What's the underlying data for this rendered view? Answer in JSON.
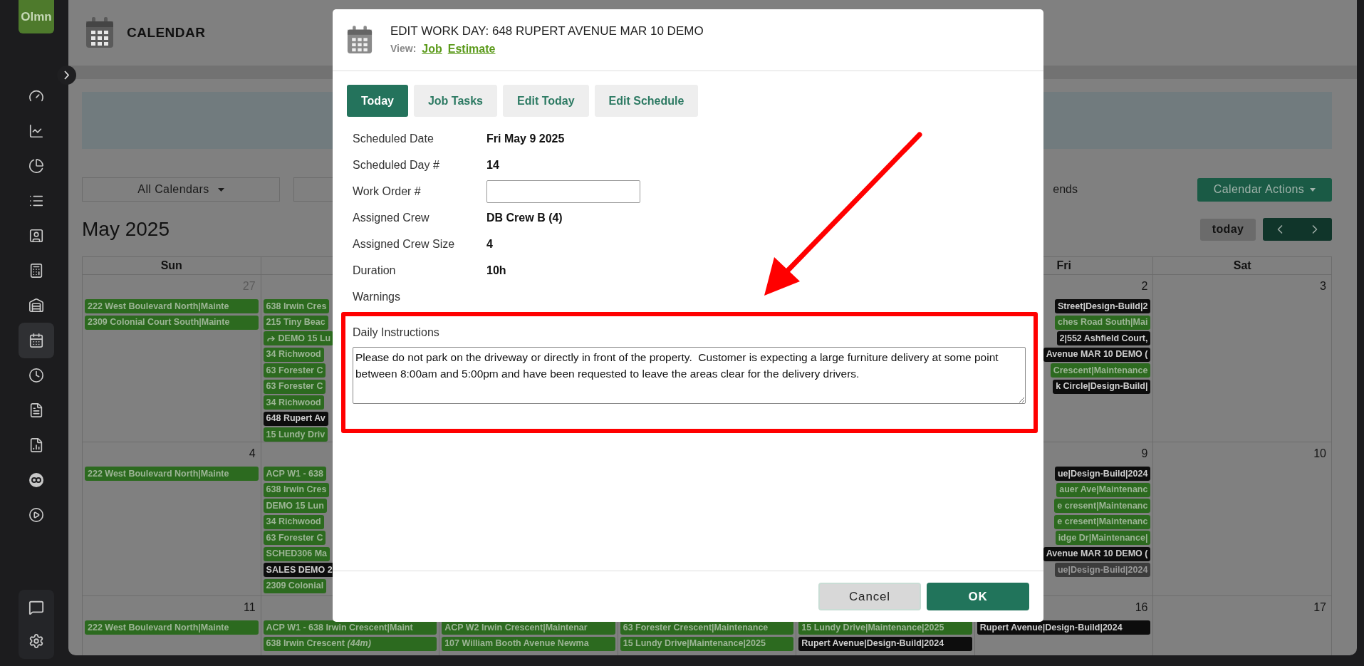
{
  "sidebar": {
    "logo": "Olmn",
    "items": [
      {
        "selected": false
      },
      {
        "selected": false
      },
      {
        "selected": false
      },
      {
        "selected": false
      },
      {
        "selected": false
      },
      {
        "selected": false
      },
      {
        "selected": false
      },
      {
        "selected": true
      },
      {
        "selected": false
      },
      {
        "selected": false
      },
      {
        "selected": false
      },
      {
        "selected": false
      },
      {
        "selected": false
      }
    ]
  },
  "page": {
    "title": "CALENDAR",
    "filter": "All Calendars",
    "weekends_label": "ends",
    "actions": "Calendar Actions",
    "today": "today",
    "month": "May 2025"
  },
  "calendar": {
    "rows": [
      {
        "cells": [
          {
            "weekday": "Sun",
            "day": "27",
            "other_month": true,
            "events": [
              {
                "text": "222 West Boulevard North|Mainte",
                "color": "#2c6a1f",
                "moved": false
              },
              {
                "text": "2309 Colonial Court South|Mainte",
                "color": "#2c6a1f",
                "moved": false
              }
            ]
          },
          {
            "events": [
              {
                "text": "638 Irwin Cres",
                "color": "#2c6a1f",
                "moved": false
              },
              {
                "text": "215 Tiny Beac",
                "color": "#2c6a1f",
                "moved": false
              },
              {
                "text": "DEMO 15 Lu",
                "color": "#2c6a1f",
                "moved": true
              },
              {
                "text": "34 Richwood",
                "color": "#2c6a1f",
                "moved": false
              },
              {
                "text": "63 Forester C",
                "color": "#2c6a1f",
                "moved": false
              },
              {
                "text": "63 Forester C",
                "color": "#2c6a1f",
                "moved": false
              },
              {
                "text": "34 Richwood",
                "color": "#2c6a1f",
                "moved": false
              },
              {
                "text": "648 Rupert Av",
                "color": "#0d0d0d",
                "moved": false
              },
              {
                "text": "15 Lundy Driv",
                "color": "#2c6a1f",
                "moved": false
              }
            ]
          },
          {},
          {},
          {},
          {
            "weekday": "Fri",
            "day": "2",
            "other_month": false,
            "events": [
              {
                "text": "Street|Design-Build|2",
                "color": "#0d0d0d",
                "moved": false
              },
              {
                "text": "ches Road South|Mai",
                "color": "#2c6a1f",
                "moved": false
              },
              {
                "text": "2|552 Ashfield Court,",
                "color": "#0d0d0d",
                "moved": false
              },
              {
                "text": "Avenue MAR 10 DEMO (",
                "color": "#0d0d0d",
                "moved": false
              },
              {
                "text": "Crescent|Maintenance",
                "color": "#2c6a1f",
                "moved": false
              },
              {
                "text": "k Circle|Design-Build|",
                "color": "#0d0d0d",
                "moved": false
              }
            ]
          },
          {
            "weekday": "Sat",
            "day": "3",
            "other_month": false
          }
        ]
      },
      {
        "cells": [
          {
            "day": "4",
            "other_month": false,
            "events": [
              {
                "text": "222 West Boulevard North|Mainte",
                "color": "#2c6a1f",
                "moved": false
              }
            ]
          },
          {
            "events": [
              {
                "text": "ACP W1 - 638",
                "color": "#2c6a1f",
                "moved": false
              },
              {
                "text": "638 Irwin Cres",
                "color": "#2c6a1f",
                "moved": false
              },
              {
                "text": "DEMO 15 Lun",
                "color": "#2c6a1f",
                "moved": false
              },
              {
                "text": "34 Richwood",
                "color": "#2c6a1f",
                "moved": false
              },
              {
                "text": "63 Forester C",
                "color": "#2c6a1f",
                "moved": false
              },
              {
                "text": "SCHED306 Ma",
                "color": "#2c6a1f",
                "moved": false
              },
              {
                "text": "SALES DEMO 2",
                "color": "#0d0d0d",
                "moved": false
              },
              {
                "text": "2309 Colonial",
                "color": "#2c6a1f",
                "moved": false
              }
            ]
          },
          {},
          {},
          {},
          {
            "day": "9",
            "other_month": false,
            "events": [
              {
                "text": "ue|Design-Build|2024",
                "color": "#0d0d0d",
                "moved": false
              },
              {
                "text": "auer Ave|Maintenanc",
                "color": "#2c6a1f",
                "moved": false
              },
              {
                "text": "e cresent|Maintenanc",
                "color": "#2c6a1f",
                "moved": false
              },
              {
                "text": "e cresent|Maintenanc",
                "color": "#2c6a1f",
                "moved": false
              },
              {
                "text": "idge Dr|Maintenance|",
                "color": "#2c6a1f",
                "moved": false
              },
              {
                "text": "Avenue MAR 10 DEMO (",
                "color": "#0d0d0d",
                "moved": false
              },
              {
                "text": "ue|Design-Build|2024",
                "color": "#3c3c3c",
                "moved": false
              }
            ]
          },
          {
            "day": "10",
            "other_month": false
          }
        ]
      },
      {
        "cells": [
          {
            "day": "11",
            "other_month": false,
            "events": [
              {
                "text": "222 West Boulevard North|Mainte",
                "color": "#2c6a1f",
                "moved": false
              }
            ]
          },
          {
            "events": [
              {
                "text": "ACP W1 - 638 Irwin Crescent|Maint",
                "color": "#2c6a1f",
                "moved": false
              },
              {
                "text": "638 Irwin Crescent *(44m)*",
                "color": "#2c6a1f",
                "moved": false
              }
            ]
          },
          {
            "events": [
              {
                "text": "ACP W2 Irwin Crescent|Maintenar",
                "color": "#2c6a1f",
                "moved": false
              },
              {
                "text": "107 William Booth Avenue Newma",
                "color": "#2c6a1f",
                "moved": false
              }
            ]
          },
          {
            "events": [
              {
                "text": "63 Forester Crescent|Maintenance",
                "color": "#2c6a1f",
                "moved": false
              },
              {
                "text": "15 Lundy Drive|Maintenance|2025",
                "color": "#2c6a1f",
                "moved": false
              }
            ]
          },
          {
            "events": [
              {
                "text": "15 Lundy Drive|Maintenance|2025",
                "color": "#2c6a1f",
                "moved": false
              },
              {
                "text": "Rupert Avenue|Design-Build|2024",
                "color": "#0d0d0d",
                "moved": false
              }
            ]
          },
          {
            "day": "16",
            "other_month": false,
            "events": [
              {
                "text": "Rupert Avenue|Design-Build|2024",
                "color": "#0d0d0d",
                "moved": false
              }
            ]
          },
          {
            "day": "17",
            "other_month": false
          }
        ]
      }
    ]
  },
  "modal": {
    "title": "EDIT WORK DAY: 648 RUPERT AVENUE MAR 10 DEMO",
    "view_label": "View:",
    "links": [
      "Job",
      "Estimate"
    ],
    "tabs": [
      {
        "label": "Today",
        "selected": true
      },
      {
        "label": "Job Tasks",
        "selected": false
      },
      {
        "label": "Edit Today",
        "selected": false
      },
      {
        "label": "Edit Schedule",
        "selected": false
      }
    ],
    "fields": [
      {
        "label": "Scheduled Date",
        "kind": "text",
        "value": "Fri May 9 2025"
      },
      {
        "label": "Scheduled Day #",
        "kind": "text",
        "value": "14"
      },
      {
        "label": "Work Order #",
        "kind": "input"
      },
      {
        "label": "Assigned Crew",
        "kind": "text",
        "value": "DB Crew B (4)"
      },
      {
        "label": "Assigned Crew Size",
        "kind": "text",
        "value": "4"
      },
      {
        "label": "Duration",
        "kind": "text",
        "value": "10h"
      },
      {
        "label": "Warnings",
        "kind": "text"
      }
    ],
    "instructions": {
      "label": "Daily Instructions",
      "value": "Please do not park on the driveway or directly in front of the property.  Customer is expecting a large furniture delivery at some point between 8:00am and 5:00pm and have been requested to leave the areas clear for the delivery drivers."
    },
    "buttons": [
      {
        "label": "Cancel",
        "kind": "secondary"
      },
      {
        "label": "OK",
        "kind": "primary"
      }
    ]
  }
}
